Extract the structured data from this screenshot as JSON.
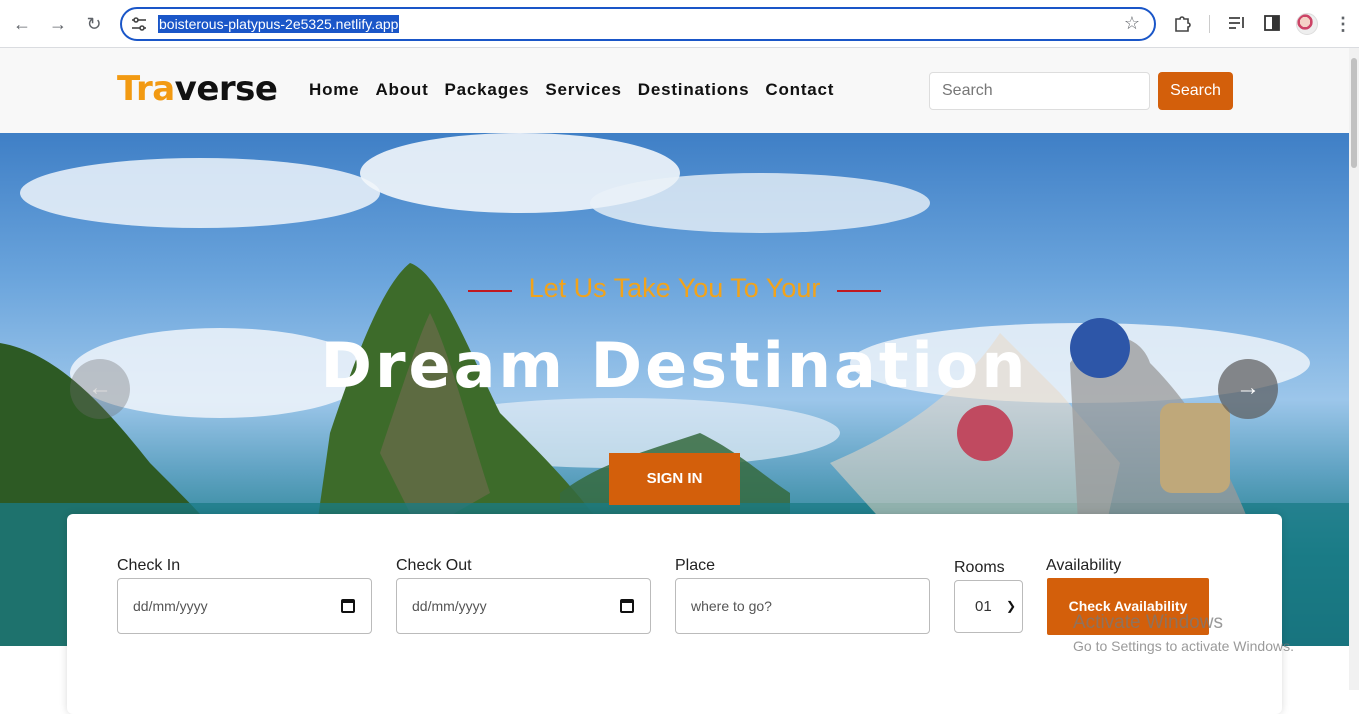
{
  "browser": {
    "url": "boisterous-platypus-2e5325.netlify.app"
  },
  "header": {
    "logo_part1": "Tra",
    "logo_part2": "verse",
    "nav": [
      "Home",
      "About",
      "Packages",
      "Services",
      "Destinations",
      "Contact"
    ],
    "search_placeholder": "Search",
    "search_button": "Search"
  },
  "hero": {
    "tagline": "Let Us Take You To Your",
    "headline": "Dream Destination",
    "signin_button": "SIGN IN",
    "prev_arrow": "←",
    "next_arrow": "→"
  },
  "booking": {
    "check_in_label": "Check In",
    "check_in_value": "dd/mm/yyyy",
    "check_out_label": "Check Out",
    "check_out_value": "dd/mm/yyyy",
    "place_label": "Place",
    "place_placeholder": "where to go?",
    "rooms_label": "Rooms",
    "rooms_value": "01",
    "availability_label": "Availability",
    "availability_button": "Check Availability"
  },
  "watermark": {
    "title": "Activate Windows",
    "subtitle": "Go to Settings to activate Windows."
  },
  "colors": {
    "accent": "#d35f0b",
    "logo_orange": "#f29a12",
    "tagline": "#f2a31a",
    "tagline_lines": "#c0191f"
  }
}
